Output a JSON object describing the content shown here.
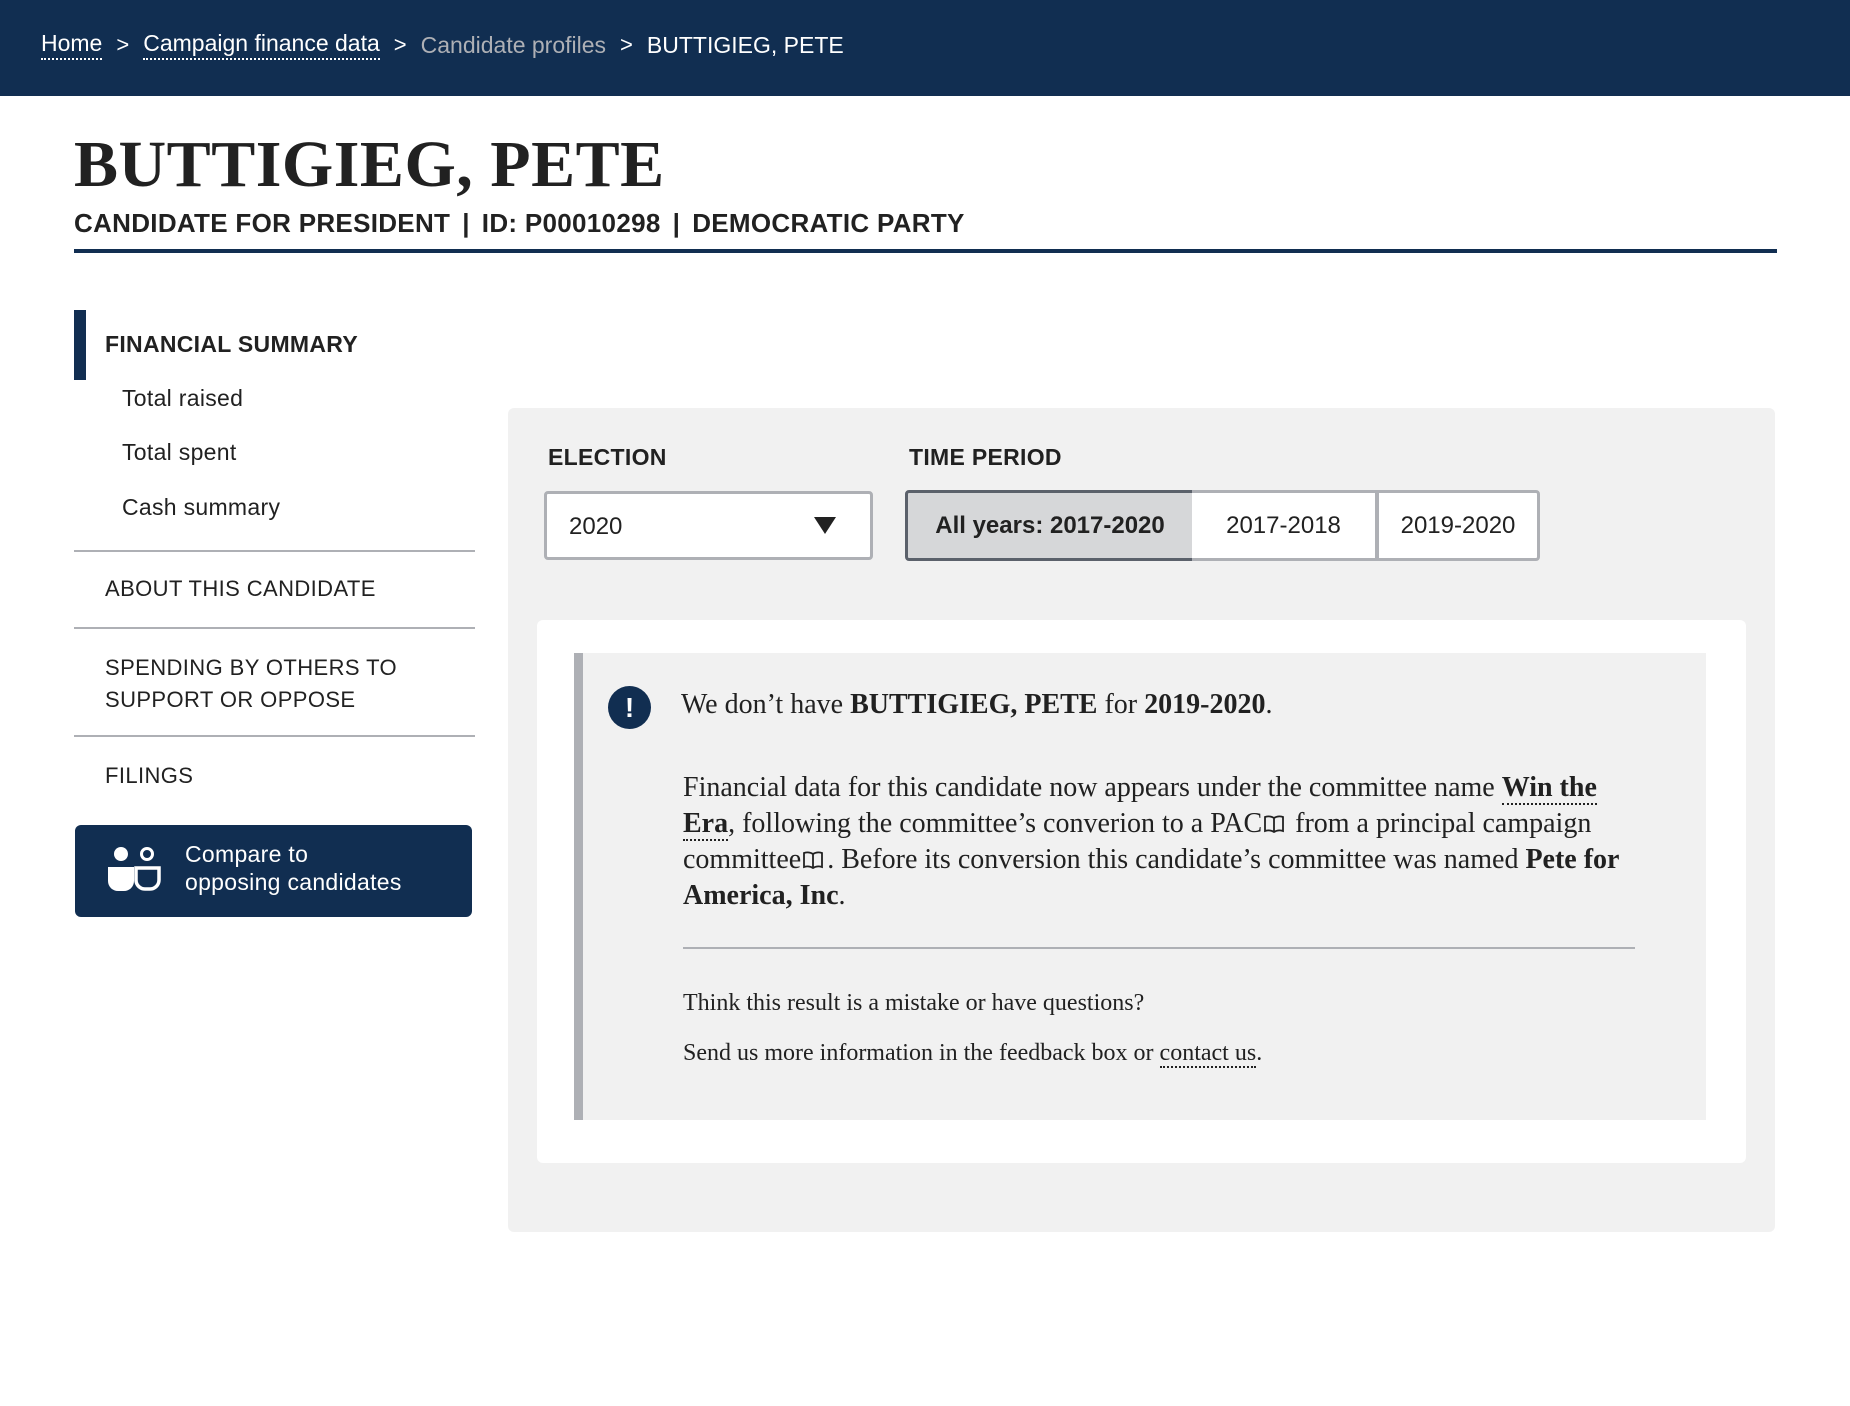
{
  "breadcrumb": {
    "home": "Home",
    "sep": ">",
    "campaign_finance": "Campaign finance data",
    "candidate_profiles": "Candidate profiles",
    "current": "BUTTIGIEG, PETE"
  },
  "header": {
    "title": "BUTTIGIEG, PETE",
    "office": "CANDIDATE FOR PRESIDENT",
    "id": "ID: P00010298",
    "party": "DEMOCRATIC PARTY",
    "divider": "|"
  },
  "sidebar": {
    "heading": "FINANCIAL SUMMARY",
    "subitems": [
      "Total raised",
      "Total spent",
      "Cash summary"
    ],
    "about": "ABOUT THIS CANDIDATE",
    "spending_line1": "SPENDING BY OTHERS TO",
    "spending_line2": "SUPPORT OR OPPOSE",
    "filings": "FILINGS",
    "compare_line1": "Compare to",
    "compare_line2": "opposing candidates"
  },
  "filters": {
    "election_label": "ELECTION",
    "election_value": "2020",
    "period_label": "TIME PERIOD",
    "periods": [
      "All years: 2017-2020",
      "2017-2018",
      "2019-2020"
    ],
    "selected_period": "All years: 2017-2020"
  },
  "message": {
    "icon_glyph": "!",
    "lead_pre": "We don’t have ",
    "lead_name": "BUTTIGIEG, PETE",
    "lead_mid": " for ",
    "lead_period": "2019-2020",
    "lead_end": ".",
    "body_1": "Financial data for this candidate now appears under the committee name ",
    "body_committee": "Win the Era",
    "body_2": ", following the committee’s converion to a PAC",
    "body_3": " from a principal campaign committee",
    "body_4": ". Before its conversion this candidate’s committee was named ",
    "body_old_name": "Pete for America, Inc",
    "body_end": ".",
    "foot_question": "Think this result is a mistake or have questions?",
    "foot_pre": "Send us more information in the feedback box or ",
    "foot_link": "contact us",
    "foot_end": "."
  },
  "colors": {
    "navy": "#112e51",
    "panel_gray": "#f1f1f1",
    "border_gray": "#aeb0b5"
  }
}
